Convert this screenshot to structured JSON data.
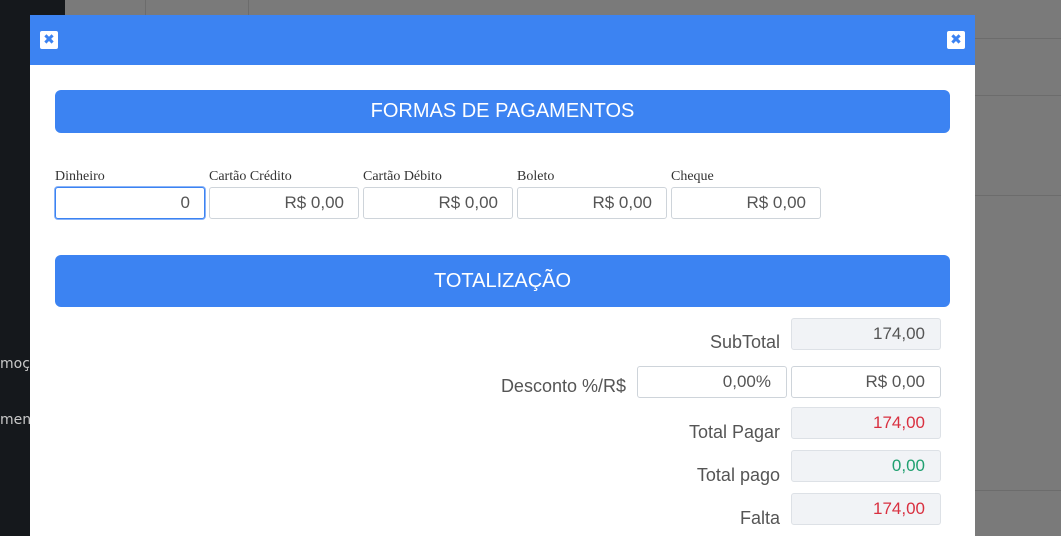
{
  "background": {
    "sidebar_text_1": "moçõ",
    "sidebar_text_2": "mento"
  },
  "modal": {
    "close_icon_left": "✖",
    "close_icon_right": "✖",
    "payment_title": "FORMAS DE PAGAMENTOS",
    "totals_title": "TOTALIZAÇÃO"
  },
  "payments": [
    {
      "label": "Dinheiro",
      "value": "0"
    },
    {
      "label": "Cartão Crédito",
      "value": "R$ 0,00"
    },
    {
      "label": "Cartão Débito",
      "value": "R$ 0,00"
    },
    {
      "label": "Boleto",
      "value": "R$ 0,00"
    },
    {
      "label": "Cheque",
      "value": "R$ 0,00"
    }
  ],
  "totals": {
    "subtotal_label": "SubTotal",
    "subtotal_value": "174,00",
    "discount_label": "Desconto %/R$",
    "discount_percent": "0,00%",
    "discount_value": "R$ 0,00",
    "total_pay_label": "Total Pagar",
    "total_pay_value": "174,00",
    "total_paid_label": "Total pago",
    "total_paid_value": "0,00",
    "missing_label": "Falta",
    "missing_value": "174,00"
  },
  "colors": {
    "accent": "#3c83f2",
    "negative": "#d93040",
    "positive": "#20a070"
  }
}
